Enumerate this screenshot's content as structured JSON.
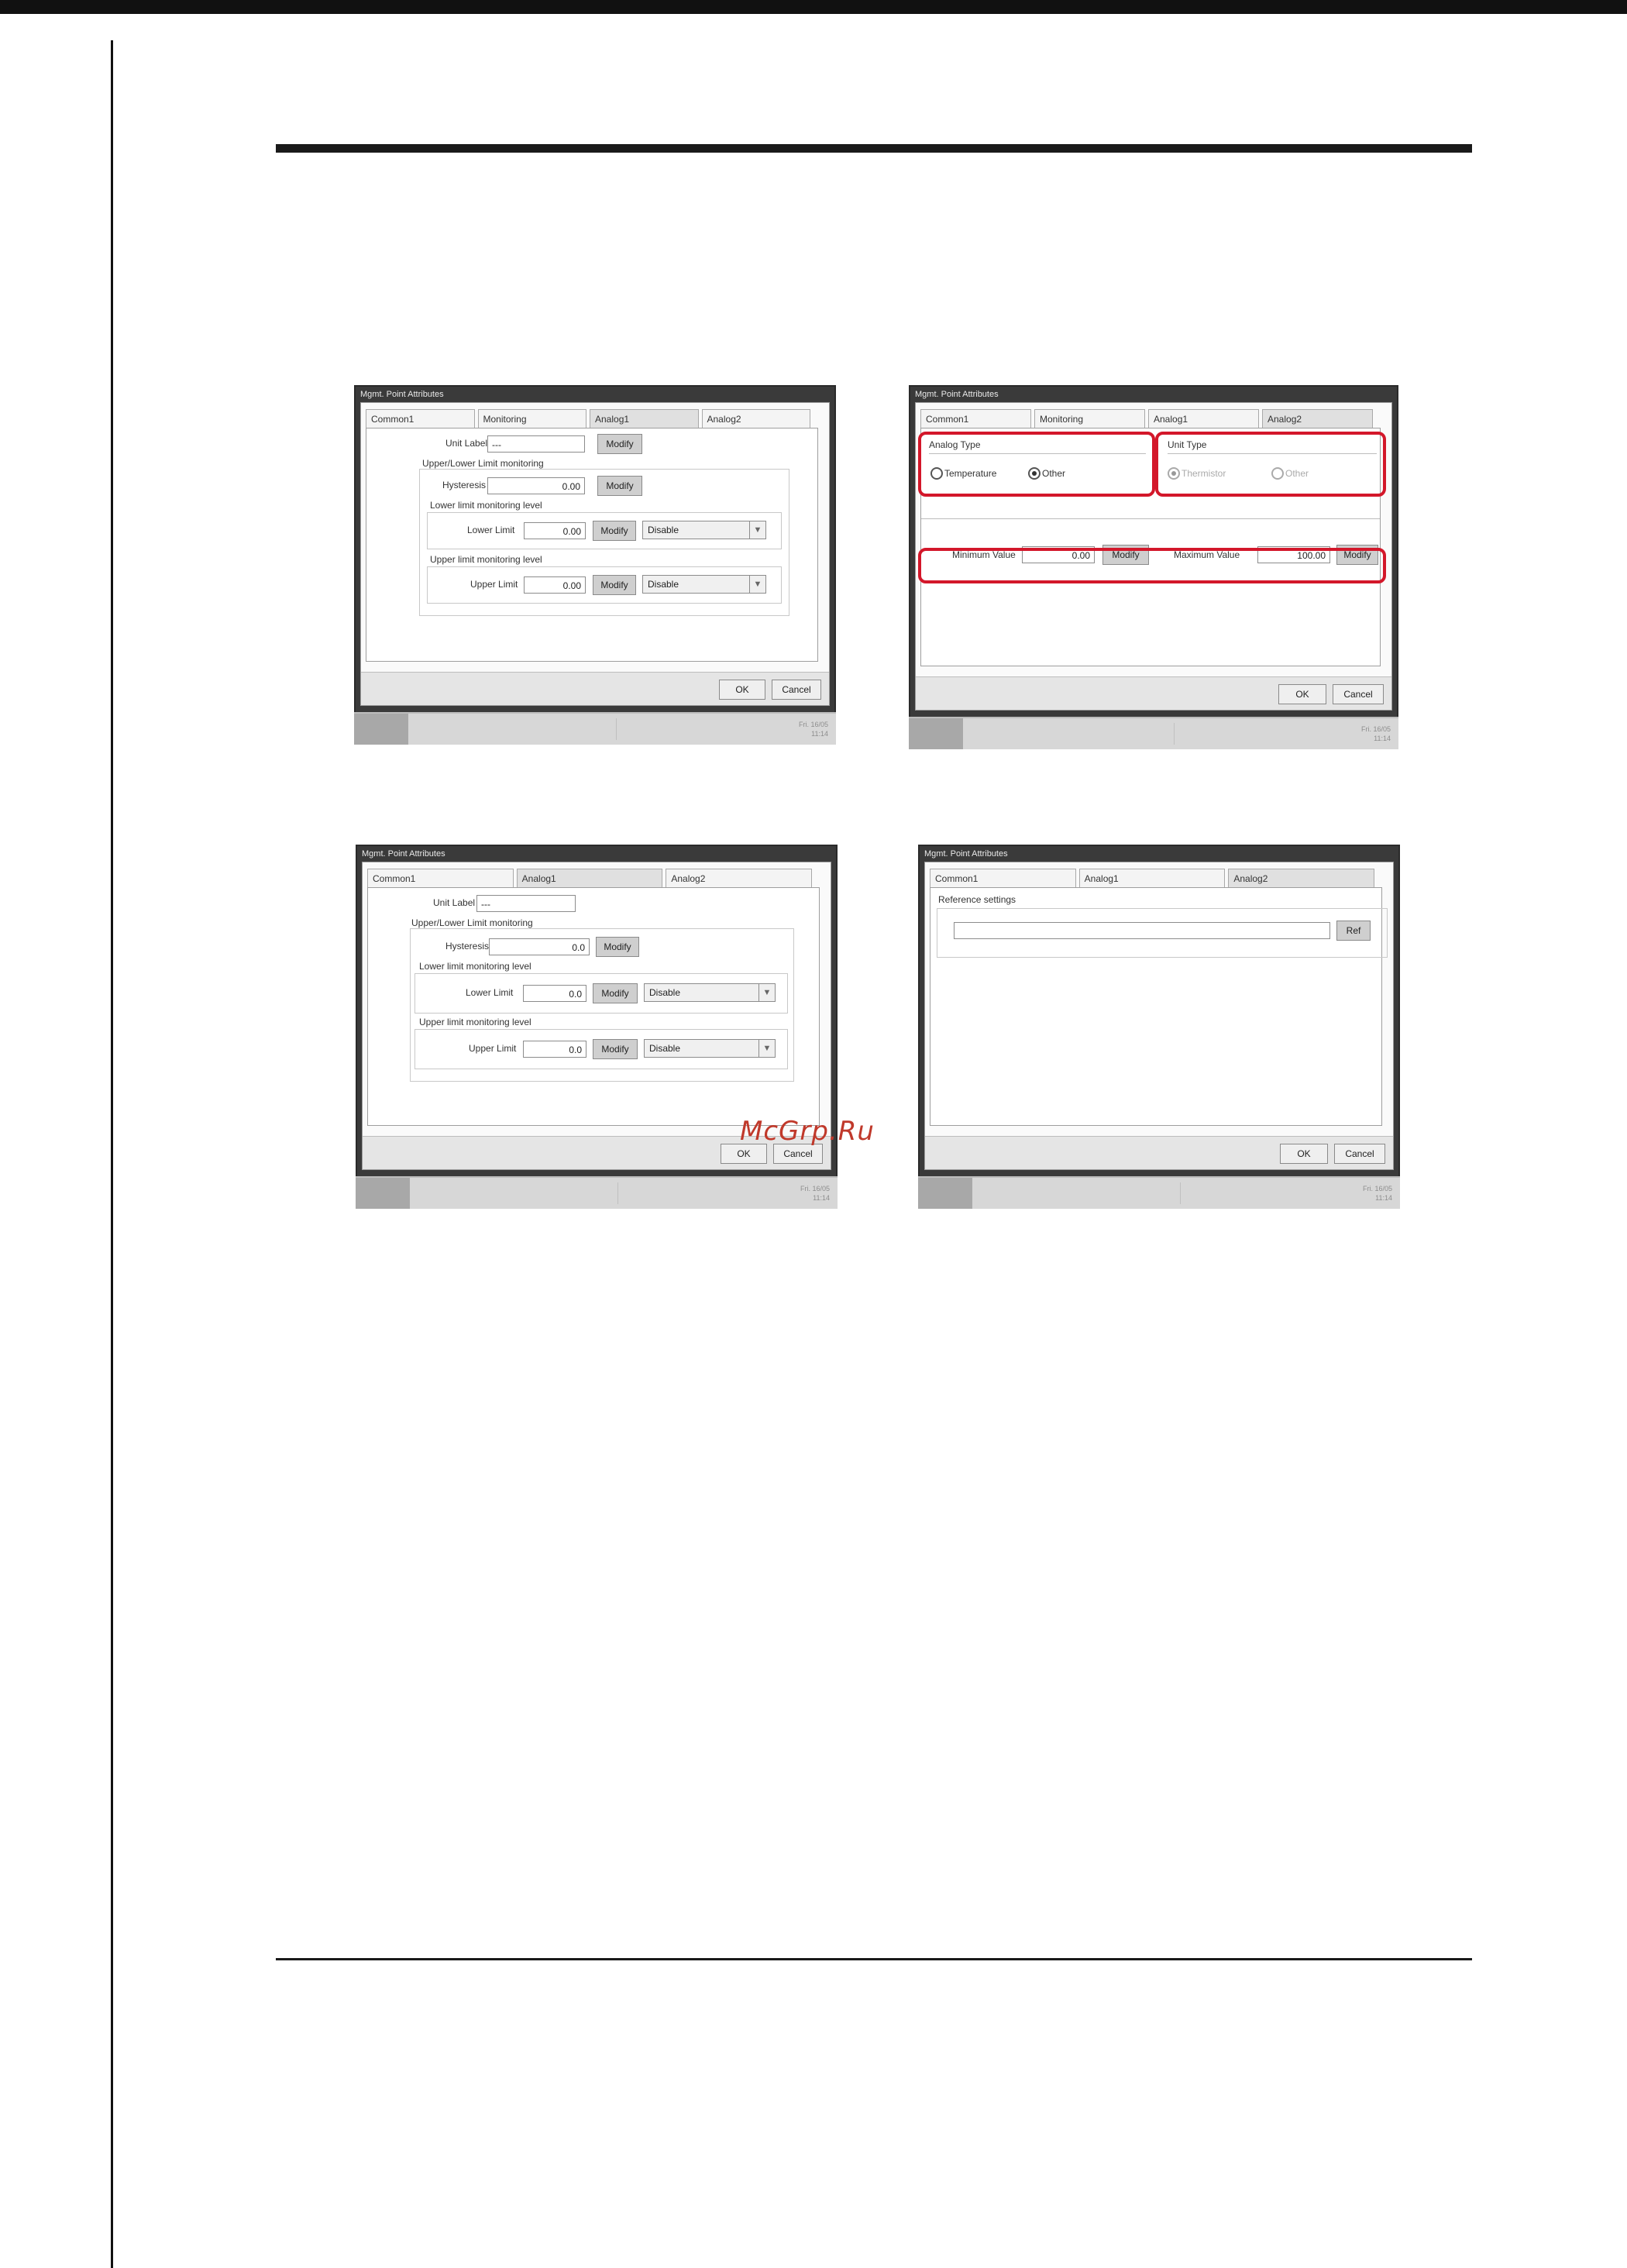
{
  "window_title": "Mgmt. Point Attributes",
  "buttons": {
    "ok": "OK",
    "cancel": "Cancel",
    "modify": "Modify",
    "ref": "Ref"
  },
  "taskbar_clock": "Fri. 16/05\n11:14",
  "watermark": "McGrp.Ru",
  "fig1": {
    "tabs": [
      "Common1",
      "Monitoring",
      "Analog1",
      "Analog2"
    ],
    "unit_label": "Unit Label",
    "unit_value": "---",
    "upper_lower": "Upper/Lower Limit monitoring",
    "hysteresis": "Hysteresis",
    "hysteresis_value": "0.00",
    "lower_level": "Lower limit monitoring level",
    "lower_limit": "Lower Limit",
    "lower_value": "0.00",
    "lower_select": "Disable",
    "upper_level": "Upper limit monitoring level",
    "upper_limit": "Upper Limit",
    "upper_value": "0.00",
    "upper_select": "Disable"
  },
  "fig2": {
    "tabs": [
      "Common1",
      "Monitoring",
      "Analog1",
      "Analog2"
    ],
    "analog_type": "Analog Type",
    "temperature": "Temperature",
    "other": "Other",
    "unit_type": "Unit Type",
    "thermistor": "Thermistor",
    "other2": "Other",
    "min_label": "Minimum Value",
    "min_value": "0.00",
    "max_label": "Maximum Value",
    "max_value": "100.00"
  },
  "fig3": {
    "tabs": [
      "Common1",
      "Analog1",
      "Analog2"
    ],
    "unit_label": "Unit Label",
    "unit_value": "---",
    "upper_lower": "Upper/Lower Limit monitoring",
    "hysteresis": "Hysteresis",
    "hysteresis_value": "0.0",
    "lower_level": "Lower limit monitoring level",
    "lower_limit": "Lower Limit",
    "lower_value": "0.0",
    "lower_select": "Disable",
    "upper_level": "Upper limit monitoring level",
    "upper_limit": "Upper Limit",
    "upper_value": "0.0",
    "upper_select": "Disable"
  },
  "fig4": {
    "tabs": [
      "Common1",
      "Analog1",
      "Analog2"
    ],
    "reference_settings": "Reference settings"
  },
  "colors": {
    "highlight": "#d3172a",
    "frame": "#3a3a3a"
  }
}
